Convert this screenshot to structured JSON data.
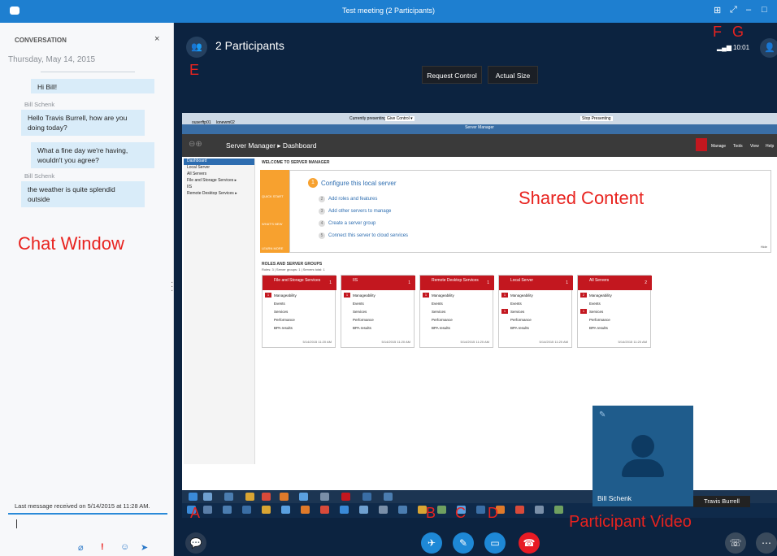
{
  "window": {
    "title": "Test meeting (2 Participants)"
  },
  "conversation": {
    "header": "CONVERSATION",
    "close": "×",
    "date": "Thursday, May 14, 2015",
    "messages": [
      {
        "sender": "",
        "text": "Hi Bill!"
      },
      {
        "sender": "Bill Schenk",
        "text": "Hello Travis Burrell, how are you doing today?"
      },
      {
        "sender": "",
        "text": "What a fine day we're having, wouldn't you agree?"
      },
      {
        "sender": "Bill Schenk",
        "text": "the weather is quite splendid outside"
      }
    ],
    "last_message": "Last message received on 5/14/2015 at 11:28 AM.",
    "annotation": "Chat Window"
  },
  "meeting": {
    "participants_label": "2 Participants",
    "request_control": "Request Control",
    "actual_size": "Actual Size",
    "time": "10:01"
  },
  "annotations": {
    "a": "A",
    "b": "B",
    "c": "C",
    "d": "D",
    "e": "E",
    "f": "F",
    "g": "G",
    "shared": "Shared Content",
    "participant": "Participant Video"
  },
  "shared": {
    "user": "ouserftp01",
    "session": "lonewm02",
    "presenting": "Currently presenting",
    "give_control": "Give Control ▾",
    "stop_presenting": "Stop Presenting",
    "app_title": "Server Manager",
    "breadcrumb": "Server Manager ▸ Dashboard",
    "menu": [
      "Manage",
      "Tools",
      "View",
      "Help"
    ],
    "nav": [
      "Dashboard",
      "Local Server",
      "All Servers",
      "File and Storage Services ▸",
      "IIS",
      "Remote Desktop Services ▸"
    ],
    "welcome": "WELCOME TO SERVER MANAGER",
    "quick_start": "QUICK START",
    "whats_new": "WHAT'S NEW",
    "learn_more": "LEARN MORE",
    "configure": "Configure this local server",
    "configure_num": "1",
    "steps": [
      {
        "n": "2",
        "text": "Add roles and features"
      },
      {
        "n": "3",
        "text": "Add other servers to manage"
      },
      {
        "n": "4",
        "text": "Create a server group"
      },
      {
        "n": "5",
        "text": "Connect this server to cloud services"
      }
    ],
    "hide": "Hide",
    "roles_header": "ROLES AND SERVER GROUPS",
    "roles_sub": "Roles: 3  |  Server groups: 1  |  Servers total: 1",
    "tiles": [
      {
        "title": "File and Storage Services",
        "count": "1",
        "badges": [
          "1",
          "",
          ""
        ],
        "ts": "5/14/2015 11:20 AM"
      },
      {
        "title": "IIS",
        "count": "1",
        "badges": [
          "1",
          "",
          ""
        ],
        "ts": "5/14/2015 11:20 AM"
      },
      {
        "title": "Remote Desktop Services",
        "count": "1",
        "badges": [
          "1",
          "",
          ""
        ],
        "ts": "5/14/2015 11:20 AM"
      },
      {
        "title": "Local Server",
        "count": "1",
        "badges": [
          "1",
          "",
          "1"
        ],
        "ts": "5/14/2015 11:20 AM"
      },
      {
        "title": "All Servers",
        "count": "2",
        "badges": [
          "2",
          "",
          "1"
        ],
        "ts": "5/14/2015 11:20 AM"
      }
    ],
    "tile_rows": [
      "Manageability",
      "Events",
      "Services",
      "Performance",
      "BPA results"
    ]
  },
  "video": {
    "participant_name": "Bill Schenk",
    "self_name": "Travis Burrell"
  }
}
